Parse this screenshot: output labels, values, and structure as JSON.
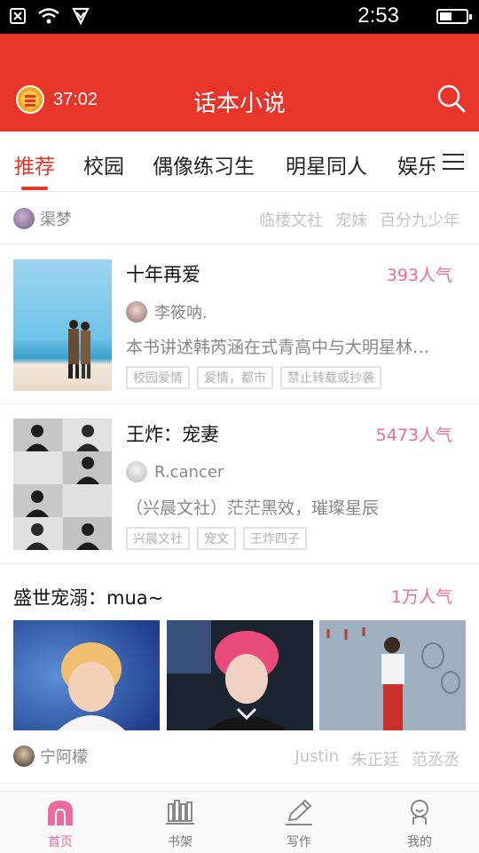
{
  "status_bar": {
    "time": "2:53",
    "battery_level": 0.45
  },
  "header": {
    "timer": "37:02",
    "title": "话本小说"
  },
  "tabs": [
    {
      "label": "推荐",
      "active": true
    },
    {
      "label": "校园"
    },
    {
      "label": "偶像练习生"
    },
    {
      "label": "明星同人"
    },
    {
      "label": "娱乐圈"
    }
  ],
  "section_1": {
    "author": "渠梦",
    "tags": [
      "临楼文社",
      "宠妹",
      "百分九少年"
    ]
  },
  "books": [
    {
      "title": "十年再爱",
      "popularity": "393人气",
      "author": "李筱呐.",
      "description": "本书讲述韩芮涵在式青高中与大明星林…",
      "tags": [
        "校园爱情",
        "爱情，都市",
        "禁止转载或抄袭"
      ]
    },
    {
      "title": "王炸：宠妻",
      "popularity": "5473人气",
      "author": "R.cancer",
      "description": "（兴晨文社）茫茫黑效，璀璨星辰",
      "tags": [
        "兴晨文社",
        "宠文",
        "王炸四子"
      ]
    }
  ],
  "recommendation": {
    "title": "盛世宠溺：mua~",
    "popularity": "1万人气",
    "author": "宁阿檬",
    "tags": [
      "Justin",
      "朱正廷",
      "范丞丞"
    ]
  },
  "bottom_nav": [
    {
      "label": "首页",
      "icon": "home-icon",
      "active": true
    },
    {
      "label": "书架",
      "icon": "bookshelf-icon"
    },
    {
      "label": "写作",
      "icon": "pen-icon"
    },
    {
      "label": "我的",
      "icon": "profile-icon"
    }
  ],
  "colors": {
    "brand_red": "#e8352a",
    "popularity_pink": "#ec6aa0"
  }
}
